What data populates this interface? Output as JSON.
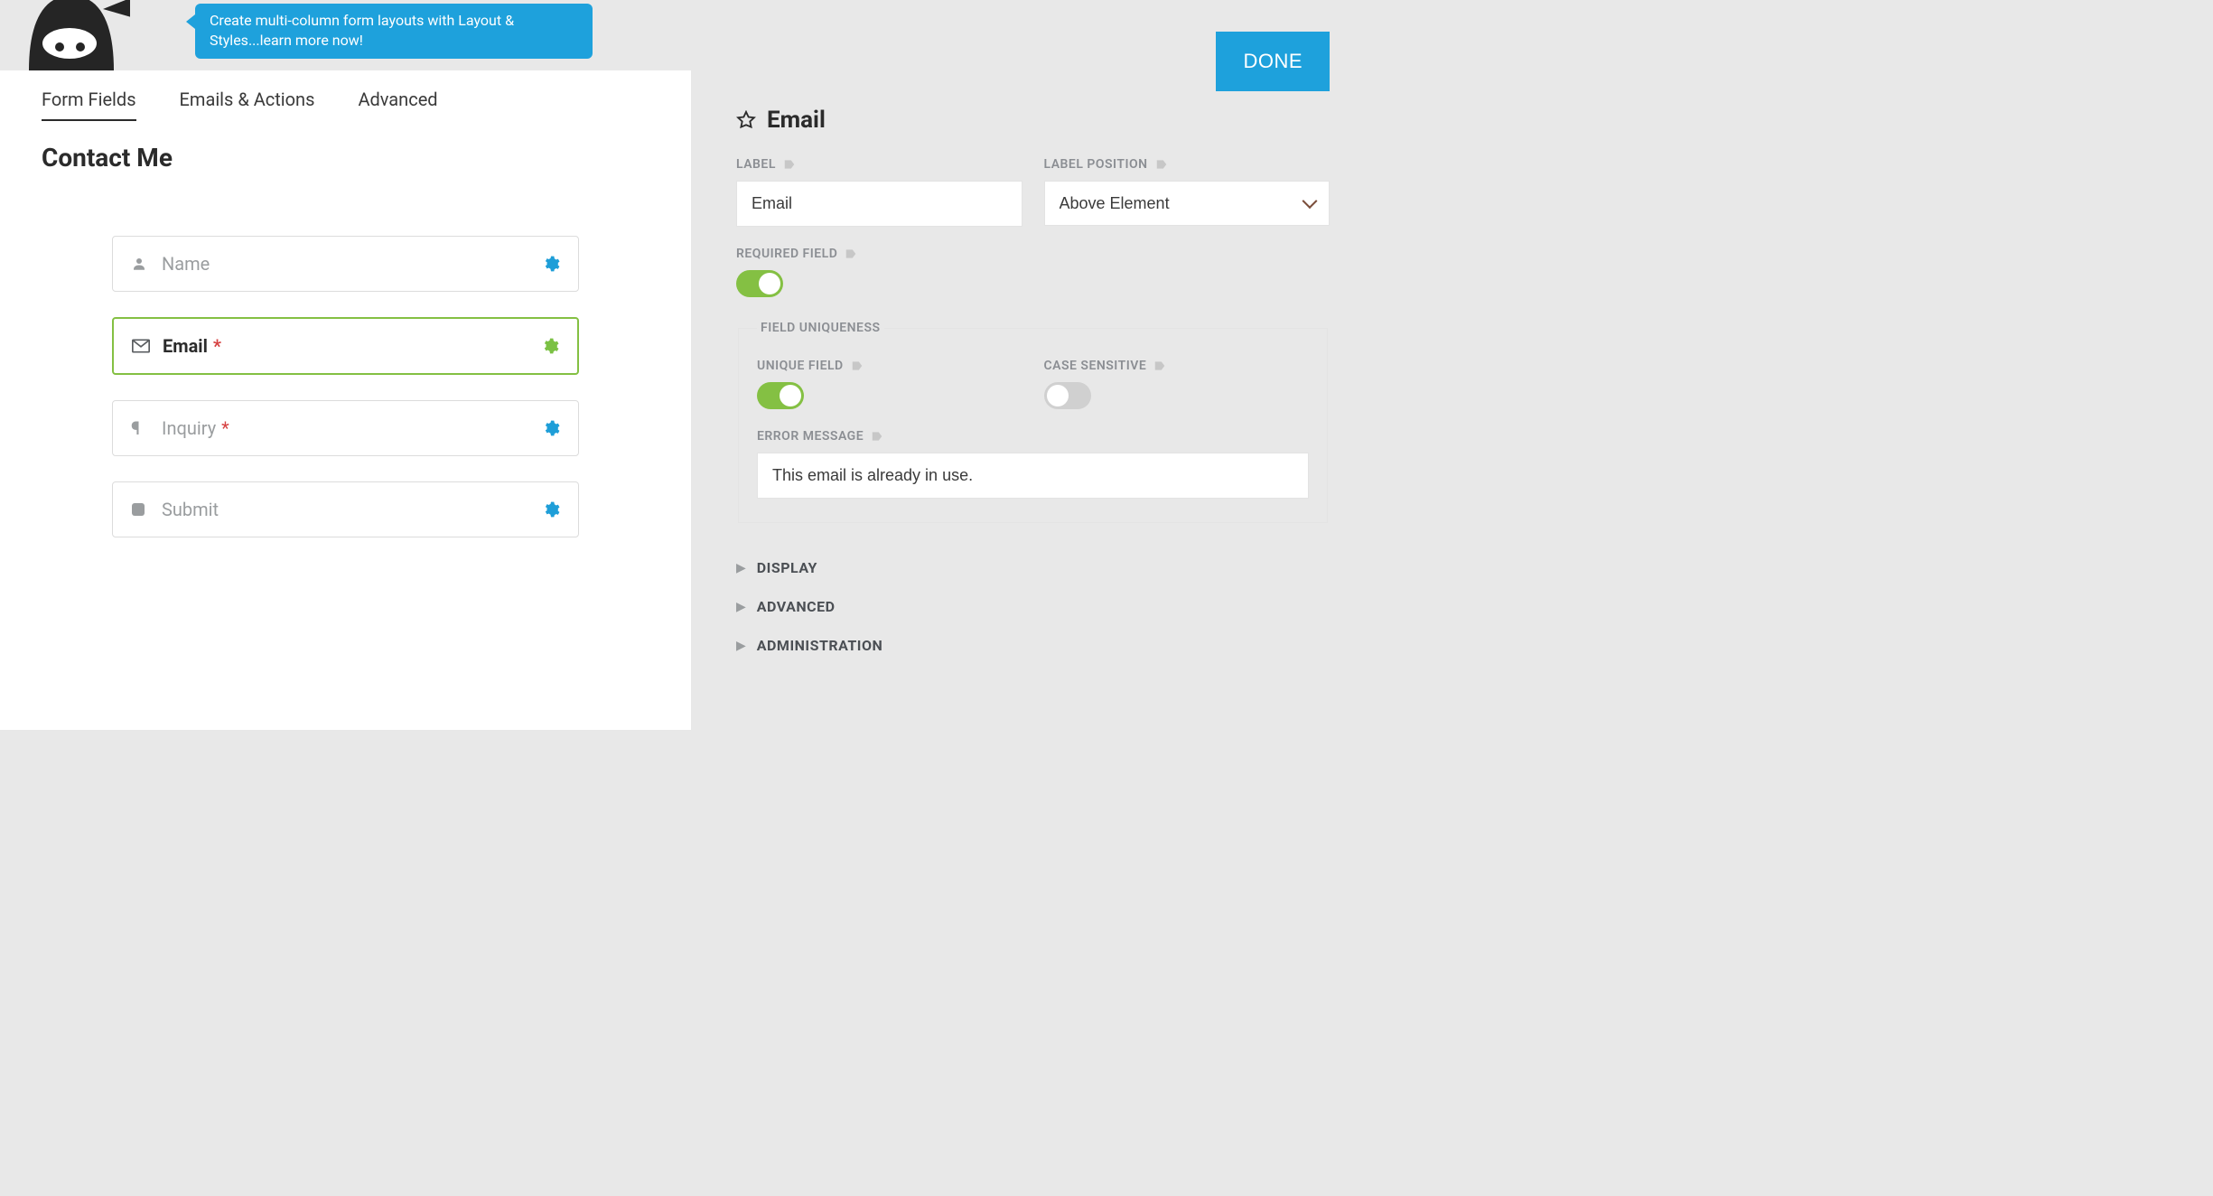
{
  "promo": "Create multi-column form layouts with Layout & Styles...learn more now!",
  "done_button": "DONE",
  "tabs": [
    {
      "label": "Form Fields",
      "selected": true
    },
    {
      "label": "Emails & Actions",
      "selected": false
    },
    {
      "label": "Advanced",
      "selected": false
    }
  ],
  "form_title": "Contact Me",
  "fields": [
    {
      "icon": "user-icon",
      "label": "Name",
      "required": false,
      "selected": false,
      "gear": "blue"
    },
    {
      "icon": "envelope-icon",
      "label": "Email",
      "required": true,
      "selected": true,
      "gear": "green"
    },
    {
      "icon": "paragraph-icon",
      "label": "Inquiry",
      "required": true,
      "selected": false,
      "gear": "blue"
    },
    {
      "icon": "square-icon",
      "label": "Submit",
      "required": false,
      "selected": false,
      "gear": "blue"
    }
  ],
  "panel": {
    "title": "Email",
    "label_heading": "LABEL",
    "label_value": "Email",
    "label_position_heading": "LABEL POSITION",
    "label_position_value": "Above Element",
    "required_heading": "REQUIRED FIELD",
    "required_on": true,
    "uniqueness_legend": "FIELD UNIQUENESS",
    "unique_heading": "UNIQUE FIELD",
    "unique_on": true,
    "case_heading": "CASE SENSITIVE",
    "case_on": false,
    "error_heading": "ERROR MESSAGE",
    "error_value": "This email is already in use.",
    "accordions": [
      "DISPLAY",
      "ADVANCED",
      "ADMINISTRATION"
    ]
  }
}
